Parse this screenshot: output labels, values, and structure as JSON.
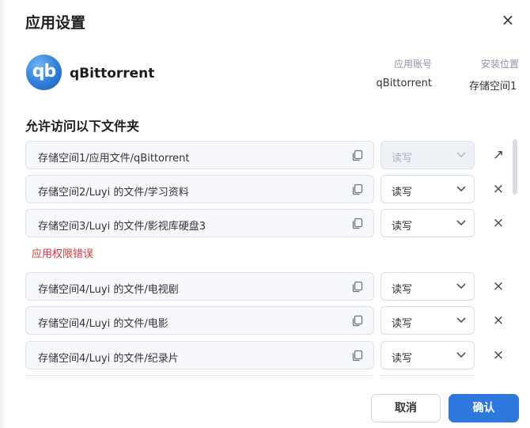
{
  "dialog": {
    "title": "应用设置",
    "close_icon": "×"
  },
  "app": {
    "logo_text": "qb",
    "name": "qBittorrent",
    "account_label": "应用账号",
    "account_value": "qBittorrent",
    "install_label": "安装位置",
    "install_value": "存储空间1"
  },
  "folders": {
    "title": "允许访问以下文件夹",
    "rows": [
      {
        "path": "存储空间1/应用文件/qBittorrent",
        "permission": "读写",
        "disabled": true,
        "action": "↗"
      },
      {
        "path": "存储空间2/Luyi 的文件/学习资料",
        "permission": "读写",
        "disabled": false,
        "action": "×"
      },
      {
        "path": "存储空间3/Luyi 的文件/影视库硬盘3",
        "permission": "读写",
        "disabled": false,
        "action": "×"
      },
      {
        "path": "存储空间4/Luyi 的文件/电视剧",
        "permission": "读写",
        "disabled": false,
        "action": "×"
      },
      {
        "path": "存储空间4/Luyi 的文件/电影",
        "permission": "读写",
        "disabled": false,
        "action": "×"
      },
      {
        "path": "存储空间4/Luyi 的文件/纪录片",
        "permission": "读写",
        "disabled": false,
        "action": "×"
      }
    ],
    "error_text": "应用权限错误"
  },
  "footer": {
    "cancel_label": "取消",
    "confirm_label": "确认"
  },
  "colors": {
    "primary": "#2d77dd",
    "error": "#e0313b"
  }
}
